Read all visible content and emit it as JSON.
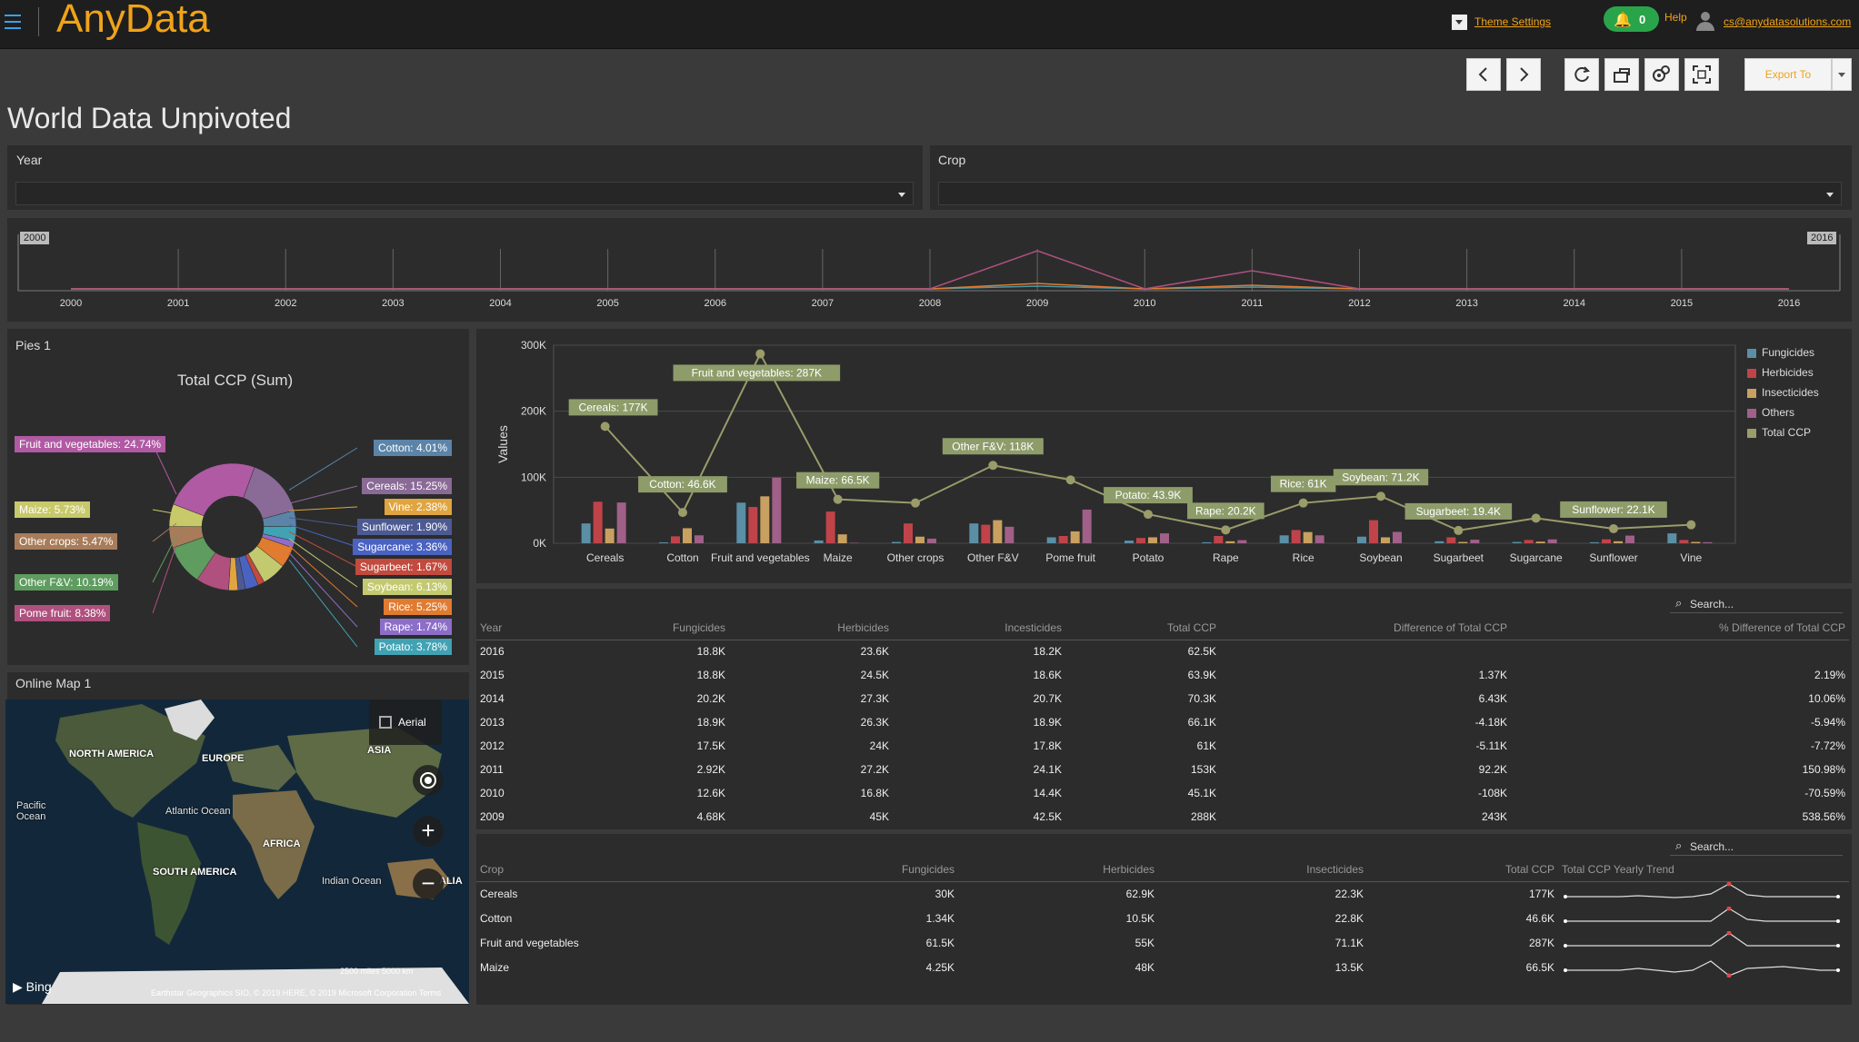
{
  "header": {
    "logo": "AnyData",
    "theme_settings": "Theme Settings",
    "notifications": "0",
    "help": "Help",
    "email": "cs@anydatasolutions.com"
  },
  "toolbar": {
    "prev": "‹",
    "next": "›",
    "export": "Export To"
  },
  "page": {
    "title": "World Data Unpivoted"
  },
  "filters": {
    "year_label": "Year",
    "crop_label": "Crop"
  },
  "timeline": {
    "start_flag": "2000",
    "end_flag": "2016",
    "years": [
      "2000",
      "2001",
      "2002",
      "2003",
      "2004",
      "2005",
      "2006",
      "2007",
      "2008",
      "2009",
      "2010",
      "2011",
      "2012",
      "2013",
      "2014",
      "2015",
      "2016"
    ]
  },
  "pies": {
    "panel_title": "Pies 1",
    "chart_title": "Total CCP (Sum)",
    "slices": [
      {
        "label": "Fruit and vegetables: 24.74%",
        "color": "#b05aa3"
      },
      {
        "label": "Maize: 5.73%",
        "color": "#c8c96a"
      },
      {
        "label": "Other crops: 5.47%",
        "color": "#a87c5a"
      },
      {
        "label": "Other F&V: 10.19%",
        "color": "#5e9c5f"
      },
      {
        "label": "Pome fruit: 8.38%",
        "color": "#b0507e"
      },
      {
        "label": "Cotton: 4.01%",
        "color": "#5b84a8"
      },
      {
        "label": "Cereals: 15.25%",
        "color": "#8a6a96"
      },
      {
        "label": "Vine: 2.38%",
        "color": "#e0a540"
      },
      {
        "label": "Sunflower: 1.90%",
        "color": "#4d5a92"
      },
      {
        "label": "Sugarcane: 3.36%",
        "color": "#4a63c2"
      },
      {
        "label": "Sugarbeet: 1.67%",
        "color": "#c24a3e"
      },
      {
        "label": "Soybean: 6.13%",
        "color": "#c3c96e"
      },
      {
        "label": "Rice: 5.25%",
        "color": "#e07b30"
      },
      {
        "label": "Rape: 1.74%",
        "color": "#8c6ec8"
      },
      {
        "label": "Potato: 3.78%",
        "color": "#41a2b4"
      }
    ]
  },
  "map": {
    "panel_title": "Online Map 1",
    "aerial": "Aerial",
    "labels": {
      "north_america": "NORTH AMERICA",
      "europe": "EUROPE",
      "asia": "ASIA",
      "pacific": "Pacific Ocean",
      "atlantic": "Atlantic Ocean",
      "africa": "AFRICA",
      "south_america": "SOUTH AMERICA",
      "indian": "Indian Ocean",
      "australia": "ALIA"
    },
    "bing": "Bing",
    "copyright": "Earthstar Geographics SIO, © 2019 HERE, © 2019 Microsoft Corporation  Terms",
    "scale": "2500 miles      5000 km"
  },
  "chart_data": {
    "type": "bar",
    "categories": [
      "Cereals",
      "Cotton",
      "Fruit and vegetables",
      "Maize",
      "Other crops",
      "Other F&V",
      "Pome fruit",
      "Potato",
      "Rape",
      "Rice",
      "Soybean",
      "Sugarbeet",
      "Sugarcane",
      "Sunflower",
      "Vine"
    ],
    "ylabel": "Values",
    "ylim": [
      0,
      300000
    ],
    "yticks": [
      "0K",
      "100K",
      "200K",
      "300K"
    ],
    "series": [
      {
        "name": "Fungicides",
        "color": "#5a8fa6",
        "values": [
          30000,
          1340,
          61500,
          4250,
          2000,
          30000,
          9000,
          4000,
          1500,
          12000,
          10000,
          3000,
          2000,
          1500,
          15000
        ]
      },
      {
        "name": "Herbicides",
        "color": "#c0434a",
        "values": [
          62900,
          10500,
          55000,
          48000,
          30000,
          28000,
          11000,
          8000,
          11000,
          20000,
          35000,
          9000,
          5000,
          6000,
          5000
        ]
      },
      {
        "name": "Insecticides",
        "color": "#c8a060",
        "values": [
          22300,
          22800,
          71100,
          13500,
          10000,
          35000,
          18000,
          9000,
          3000,
          17000,
          9000,
          2000,
          2500,
          3000,
          2000
        ]
      },
      {
        "name": "Others",
        "color": "#a06088",
        "values": [
          61700,
          12000,
          99400,
          700,
          7000,
          25000,
          51000,
          15000,
          4700,
          12000,
          17200,
          5400,
          5900,
          11600,
          1600
        ]
      },
      {
        "name": "Total CCP",
        "color": "#9a9c6a",
        "type": "line",
        "values": [
          177000,
          46600,
          287000,
          66500,
          61000,
          118000,
          96000,
          43900,
          20200,
          61000,
          71200,
          19400,
          38000,
          22100,
          28000
        ]
      }
    ],
    "data_labels": [
      {
        "index": 0,
        "text": "Cereals: 177K"
      },
      {
        "index": 1,
        "text": "Cotton: 46.6K"
      },
      {
        "index": 2,
        "text": "Fruit and vegetables: 287K"
      },
      {
        "index": 3,
        "text": "Maize: 66.5K"
      },
      {
        "index": 5,
        "text": "Other F&V: 118K"
      },
      {
        "index": 7,
        "text": "Potato: 43.9K"
      },
      {
        "index": 8,
        "text": "Rape: 20.2K"
      },
      {
        "index": 9,
        "text": "Rice: 61K"
      },
      {
        "index": 10,
        "text": "Soybean: 71.2K"
      },
      {
        "index": 11,
        "text": "Sugarbeet: 19.4K"
      },
      {
        "index": 13,
        "text": "Sunflower: 22.1K"
      }
    ],
    "legend_position": "right"
  },
  "table1": {
    "search": "Search...",
    "headers": [
      "Year",
      "Fungicides",
      "Herbicides",
      "Incesticides",
      "Total CCP",
      "Difference of Total CCP",
      "% Difference of Total CCP"
    ],
    "rows": [
      [
        "2016",
        "18.8K",
        "23.6K",
        "18.2K",
        "62.5K",
        "",
        ""
      ],
      [
        "2015",
        "18.8K",
        "24.5K",
        "18.6K",
        "63.9K",
        "1.37K",
        "2.19%"
      ],
      [
        "2014",
        "20.2K",
        "27.3K",
        "20.7K",
        "70.3K",
        "6.43K",
        "10.06%"
      ],
      [
        "2013",
        "18.9K",
        "26.3K",
        "18.9K",
        "66.1K",
        "-4.18K",
        "-5.94%"
      ],
      [
        "2012",
        "17.5K",
        "24K",
        "17.8K",
        "61K",
        "-5.11K",
        "-7.72%"
      ],
      [
        "2011",
        "2.92K",
        "27.2K",
        "24.1K",
        "153K",
        "92.2K",
        "150.98%"
      ],
      [
        "2010",
        "12.6K",
        "16.8K",
        "14.4K",
        "45.1K",
        "-108K",
        "-70.59%"
      ],
      [
        "2009",
        "4.68K",
        "45K",
        "42.5K",
        "288K",
        "243K",
        "538.56%"
      ]
    ]
  },
  "table2": {
    "search": "Search...",
    "headers": [
      "Crop",
      "Fungicides",
      "Herbicides",
      "Insecticides",
      "Total CCP",
      "Total CCP Yearly Trend"
    ],
    "rows": [
      [
        "Cereals",
        "30K",
        "62.9K",
        "22.3K",
        "177K"
      ],
      [
        "Cotton",
        "1.34K",
        "10.5K",
        "22.8K",
        "46.6K"
      ],
      [
        "Fruit and vegetables",
        "61.5K",
        "55K",
        "71.1K",
        "287K"
      ],
      [
        "Maize",
        "4.25K",
        "48K",
        "13.5K",
        "66.5K"
      ]
    ]
  }
}
